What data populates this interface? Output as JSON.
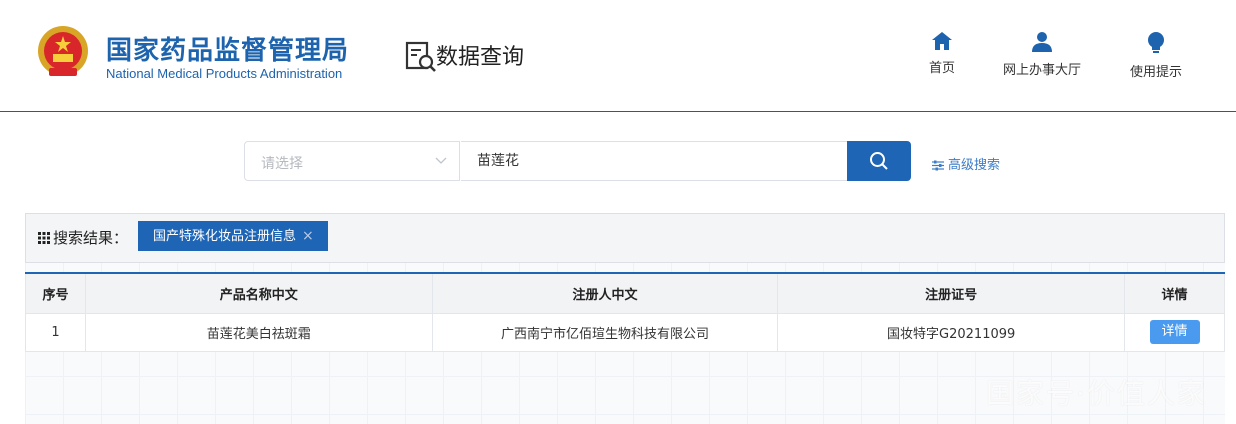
{
  "header": {
    "brand_cn": "国家药品监督管理局",
    "brand_en": "National Medical Products Administration",
    "query_title": "数据查询",
    "nav": [
      {
        "label": "首页",
        "icon": "home-icon"
      },
      {
        "label": "网上办事大厅",
        "icon": "user-icon"
      },
      {
        "label": "使用提示",
        "icon": "lightbulb-icon"
      }
    ]
  },
  "search": {
    "select_placeholder": "请选择",
    "query_value": "苗莲花",
    "advanced_label": "高级搜索"
  },
  "results": {
    "label": "搜索结果：",
    "filter_tag": "国产特殊化妆品注册信息",
    "tag_close": "×"
  },
  "table": {
    "headers": [
      "序号",
      "产品名称中文",
      "注册人中文",
      "注册证号",
      "详情"
    ],
    "rows": [
      {
        "index": "1",
        "product_name": "苗莲花美白祛斑霜",
        "registrant": "广西南宁市亿佰瑄生物科技有限公司",
        "cert_no": "国妆特字G20211099",
        "detail_label": "详情"
      }
    ]
  },
  "watermark": "国家号·价值人家",
  "colors": {
    "brand_blue": "#1d63ad",
    "button_blue": "#1e65b6",
    "detail_blue": "#4a9bef"
  }
}
